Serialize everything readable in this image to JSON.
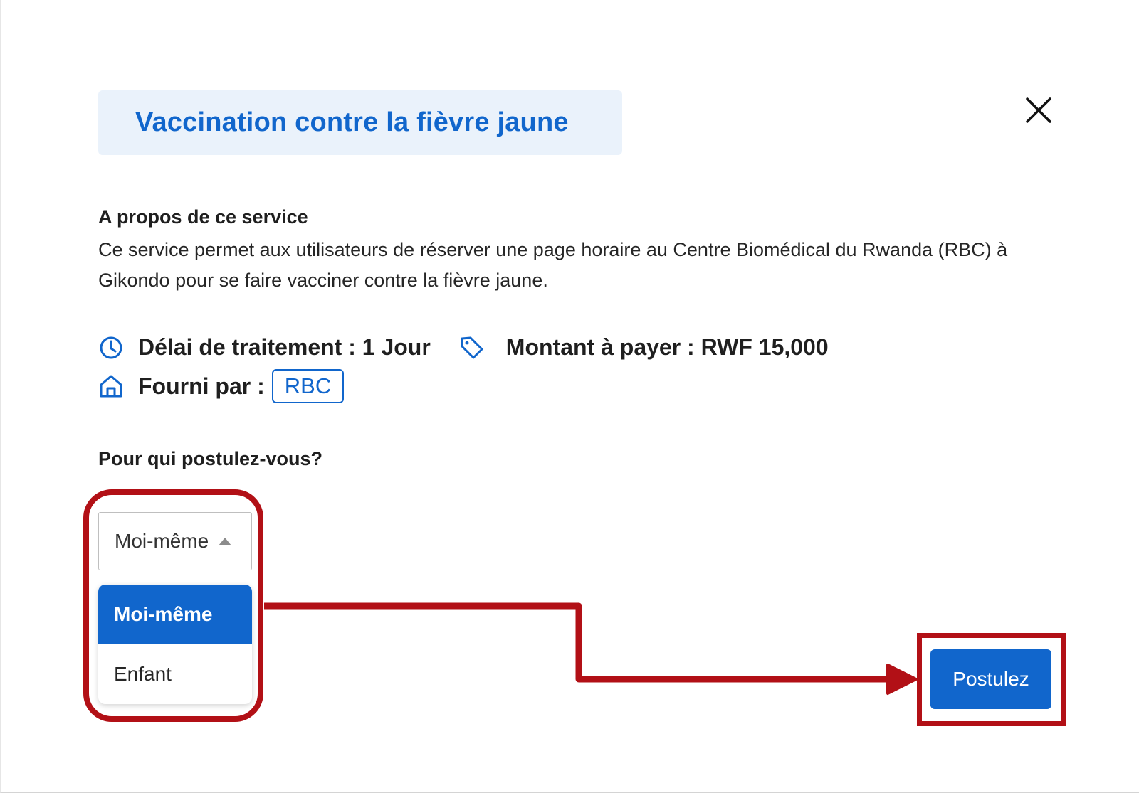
{
  "dialog": {
    "title": "Vaccination contre la fièvre jaune",
    "close_icon": "close-icon"
  },
  "about": {
    "heading": "A propos de ce service",
    "text": "Ce service permet aux utilisateurs de réserver une page horaire au Centre Biomédical du Rwanda (RBC) à Gikondo pour se faire vacciner contre la fièvre jaune."
  },
  "info": {
    "delay_icon": "clock-icon",
    "delay_text": "Délai de traitement : 1 Jour",
    "amount_icon": "tag-icon",
    "amount_text": "Montant à payer : RWF 15,000",
    "provider_icon": "home-icon",
    "provider_label": "Fourni par :",
    "provider_value": "RBC"
  },
  "applicant": {
    "question": "Pour qui postulez-vous?",
    "selected_value": "Moi-même",
    "options": [
      {
        "label": "Moi-même",
        "selected": true
      },
      {
        "label": "Enfant",
        "selected": false
      }
    ]
  },
  "actions": {
    "apply_label": "Postulez"
  },
  "colors": {
    "accent": "#1166cc",
    "title_bg": "#eaf2fb",
    "annotation": "#b21016"
  }
}
